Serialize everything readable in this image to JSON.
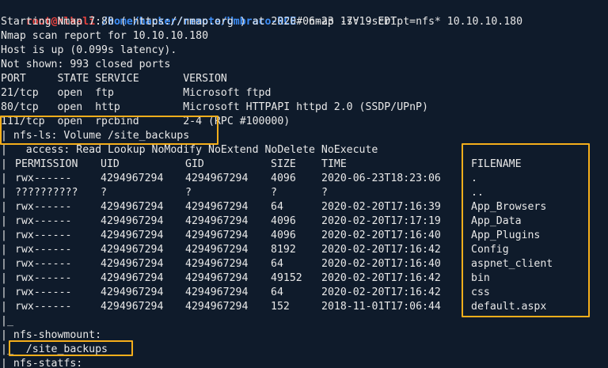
{
  "prompt": {
    "user_host": "root@hlkali",
    "separator": ":",
    "path": "/home/hacker/remote/Umbraco-RCE",
    "symbol": "#",
    "command": " nmap -sV -script=nfs* 10.10.10.180"
  },
  "header_lines": [
    "Starting Nmap 7.80 ( https://nmap.org ) at 2020-06-23 17:19 EDT",
    "Nmap scan report for 10.10.10.180",
    "Host is up (0.099s latency).",
    "Not shown: 993 closed ports",
    "PORT     STATE SERVICE       VERSION",
    "21/tcp   open  ftp           Microsoft ftpd",
    "80/tcp   open  http          Microsoft HTTPAPI httpd 2.0 (SSDP/UPnP)",
    "111/tcp  open  rpcbind       2-4 (RPC #100000)",
    "| nfs-ls: Volume /site_backups",
    "|   access: Read Lookup NoModify NoExtend NoDelete NoExecute"
  ],
  "table": {
    "headers": [
      "PERMISSION",
      "UID",
      "GID",
      "SIZE",
      "TIME",
      "FILENAME"
    ],
    "rows": [
      [
        "rwx------",
        "4294967294",
        "4294967294",
        "4096",
        "2020-06-23T18:23:06",
        "."
      ],
      [
        "??????????",
        "?",
        "?",
        "?",
        "?",
        ".."
      ],
      [
        "rwx------",
        "4294967294",
        "4294967294",
        "64",
        "2020-02-20T17:16:39",
        "App_Browsers"
      ],
      [
        "rwx------",
        "4294967294",
        "4294967294",
        "4096",
        "2020-02-20T17:17:19",
        "App_Data"
      ],
      [
        "rwx------",
        "4294967294",
        "4294967294",
        "4096",
        "2020-02-20T17:16:40",
        "App_Plugins"
      ],
      [
        "rwx------",
        "4294967294",
        "4294967294",
        "8192",
        "2020-02-20T17:16:42",
        "Config"
      ],
      [
        "rwx------",
        "4294967294",
        "4294967294",
        "64",
        "2020-02-20T17:16:40",
        "aspnet_client"
      ],
      [
        "rwx------",
        "4294967294",
        "4294967294",
        "49152",
        "2020-02-20T17:16:42",
        "bin"
      ],
      [
        "rwx------",
        "4294967294",
        "4294967294",
        "64",
        "2020-02-20T17:16:42",
        "css"
      ],
      [
        "rwx------",
        "4294967294",
        "4294967294",
        "152",
        "2018-11-01T17:06:44",
        "default.aspx"
      ]
    ]
  },
  "footer_lines": [
    "|_",
    "| nfs-showmount:",
    "|_  /site_backups",
    "| nfs-statfs:"
  ],
  "colors": {
    "background": "#0f1b2b",
    "text": "#e8e8e8",
    "user_host": "#e8423f",
    "path": "#3e8ef7",
    "highlight_box": "#f5ae1b"
  }
}
